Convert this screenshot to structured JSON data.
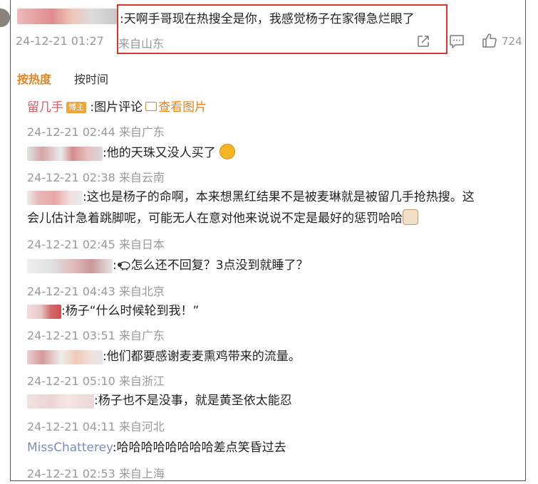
{
  "main_comment": {
    "text": ":天啊手哥现在热搜全是你，我感觉杨子在家得急烂眼了",
    "time": "24-12-21 01:27",
    "location": "来自山东",
    "like_count": "724"
  },
  "sort": {
    "hot": "按热度",
    "time": "按时间"
  },
  "replies": [
    {
      "name": "留几手",
      "badge": "博主",
      "text": ":图片评论",
      "link": "查看图片",
      "time": "24-12-21 02:44",
      "location": "来自广东"
    },
    {
      "text": ":他的天珠又没人买了",
      "time": "24-12-21 02:38",
      "location": "来自云南"
    },
    {
      "text_line1": ":这也是杨子的命啊，本来想黑红结果不是被麦琳就是被留几手抢热搜。这",
      "text_line2": "会儿估计急着跳脚呢，可能无人在意对他来说说不定是最好的惩罚哈哈",
      "time": "24-12-21 02:45",
      "location": "来自日本"
    },
    {
      "text": "怎么还不回复？3点没到就睡了？",
      "time": "24-12-21 04:43",
      "location": "来自北京"
    },
    {
      "text": ":杨子“什么时候轮到我！”",
      "time": "24-12-21 03:51",
      "location": "来自广东"
    },
    {
      "text": ":他们都要感谢麦麦熏鸡带来的流量。",
      "time": "24-12-21 05:10",
      "location": "来自浙江"
    },
    {
      "text": ":杨子也不是没事，就是黄圣依太能忍",
      "time": "24-12-21 04:11",
      "location": "来自河北"
    },
    {
      "name": "MissChatterey",
      "text": ":哈哈哈哈哈哈哈哈差点笑昏过去",
      "time": "24-12-21 02:53",
      "location": "来自上海"
    }
  ]
}
